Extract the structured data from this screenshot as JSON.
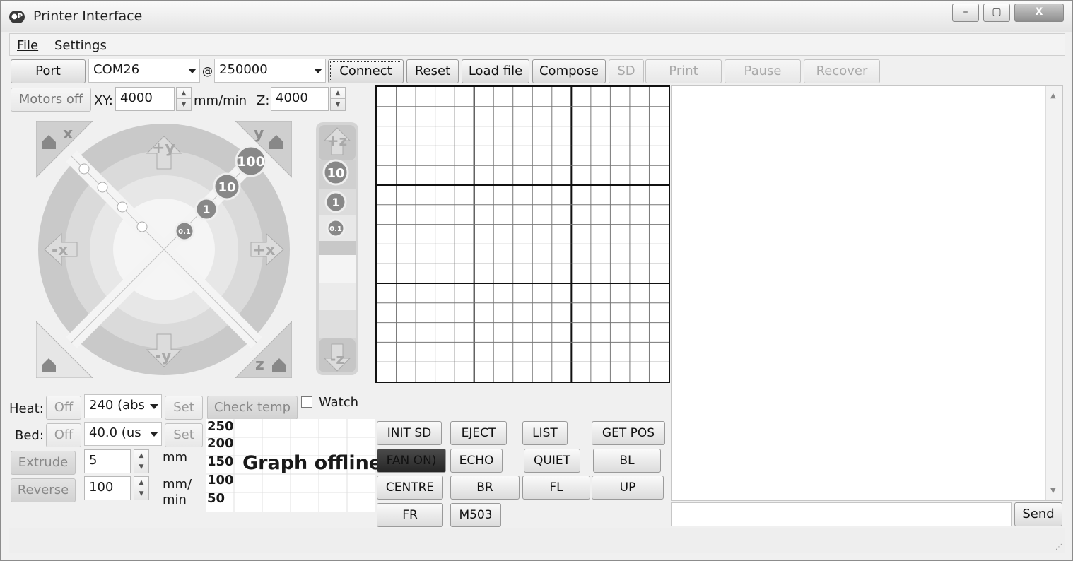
{
  "window": {
    "title": "Printer Interface",
    "minimize": "–",
    "maximize": "▢",
    "close": "X"
  },
  "menu": [
    {
      "label": "File",
      "accel": "F"
    },
    {
      "label": "Settings",
      "accel": "S"
    }
  ],
  "toolbar": {
    "port_label": "Port",
    "port_value": "COM26",
    "at": "@",
    "baud_value": "250000",
    "connect": "Connect",
    "reset": "Reset",
    "load_file": "Load file",
    "compose": "Compose",
    "sd": "SD",
    "print": "Print",
    "pause": "Pause",
    "recover": "Recover"
  },
  "motion": {
    "motors_off": "Motors off",
    "xy_label": "XY:",
    "xy_value": "4000",
    "xy_unit": "mm/min",
    "z_label": "Z:",
    "z_value": "4000"
  },
  "xy_jog": {
    "home_x": "x",
    "home_y": "y",
    "home_z": "z",
    "plus_y": "+y",
    "minus_y": "-y",
    "plus_x": "+x",
    "minus_x": "-x",
    "steps": [
      "100",
      "10",
      "1",
      "0.1"
    ]
  },
  "z_jog": {
    "plus_z": "+z",
    "minus_z": "-z",
    "steps": [
      "10",
      "1",
      "0.1"
    ]
  },
  "temps": {
    "heat_label": "Heat:",
    "heat_off": "Off",
    "heat_value": "240 (abs",
    "heat_set": "Set",
    "check_temp": "Check temp",
    "watch": "Watch",
    "bed_label": "Bed:",
    "bed_off": "Off",
    "bed_value": "40.0 (us",
    "bed_set": "Set"
  },
  "extrude": {
    "extrude": "Extrude",
    "extrude_value": "5",
    "extrude_unit": "mm",
    "reverse": "Reverse",
    "feed_value": "100",
    "feed_unit_1": "mm/",
    "feed_unit_2": "min"
  },
  "graph": {
    "ticks": [
      "250",
      "200",
      "150",
      "100",
      "50"
    ],
    "message": "Graph offline"
  },
  "macros": {
    "init_sd": "INIT SD",
    "eject": "EJECT",
    "list": "LIST",
    "get_pos": "GET POS",
    "fan_on": "FAN ON)",
    "echo": "ECHO",
    "quiet": "QUIET",
    "bl": "BL",
    "centre": "CENTRE",
    "br": "BR",
    "fl": "FL",
    "up": "UP",
    "fr": "FR",
    "m503": "M503"
  },
  "console": {
    "send": "Send"
  }
}
